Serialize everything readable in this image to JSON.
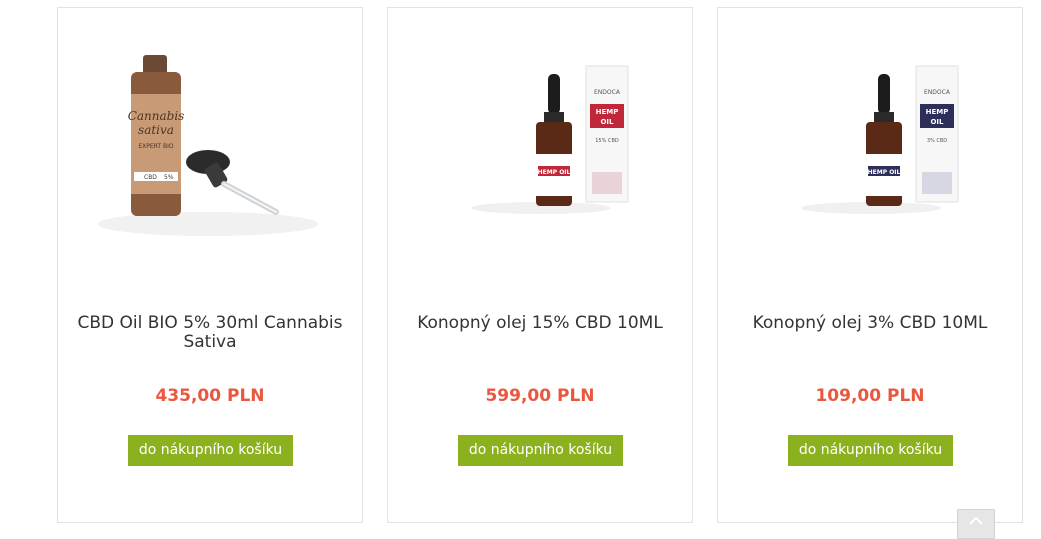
{
  "products": [
    {
      "title": "CBD Oil BIO 5% 30ml Cannabis Sativa",
      "price": "435,00 PLN",
      "button": "do nákupního košíku",
      "label_line1": "Cannabis",
      "label_line2": "sativa",
      "label_line3": "EXPERT BIO",
      "label_cbd": "CBD",
      "label_pct": "5%"
    },
    {
      "title": "Konopný olej 15% CBD 10ML",
      "price": "599,00 PLN",
      "button": "do nákupního košíku",
      "box_brand": "ENDOCA",
      "box_product_1": "HEMP",
      "box_product_2": "OIL",
      "box_pct": "15% CBD"
    },
    {
      "title": "Konopný olej 3% CBD 10ML",
      "price": "109,00 PLN",
      "button": "do nákupního košíku",
      "box_brand": "ENDOCA",
      "box_product_1": "HEMP",
      "box_product_2": "OIL",
      "box_pct": "3% CBD"
    }
  ],
  "colors": {
    "price": "#e9573f",
    "button": "#8cb11f",
    "endoca_red": "#c0283a",
    "endoca_navy": "#2d2f5a"
  },
  "icons": {
    "scroll_top": "chevron-up-icon"
  }
}
